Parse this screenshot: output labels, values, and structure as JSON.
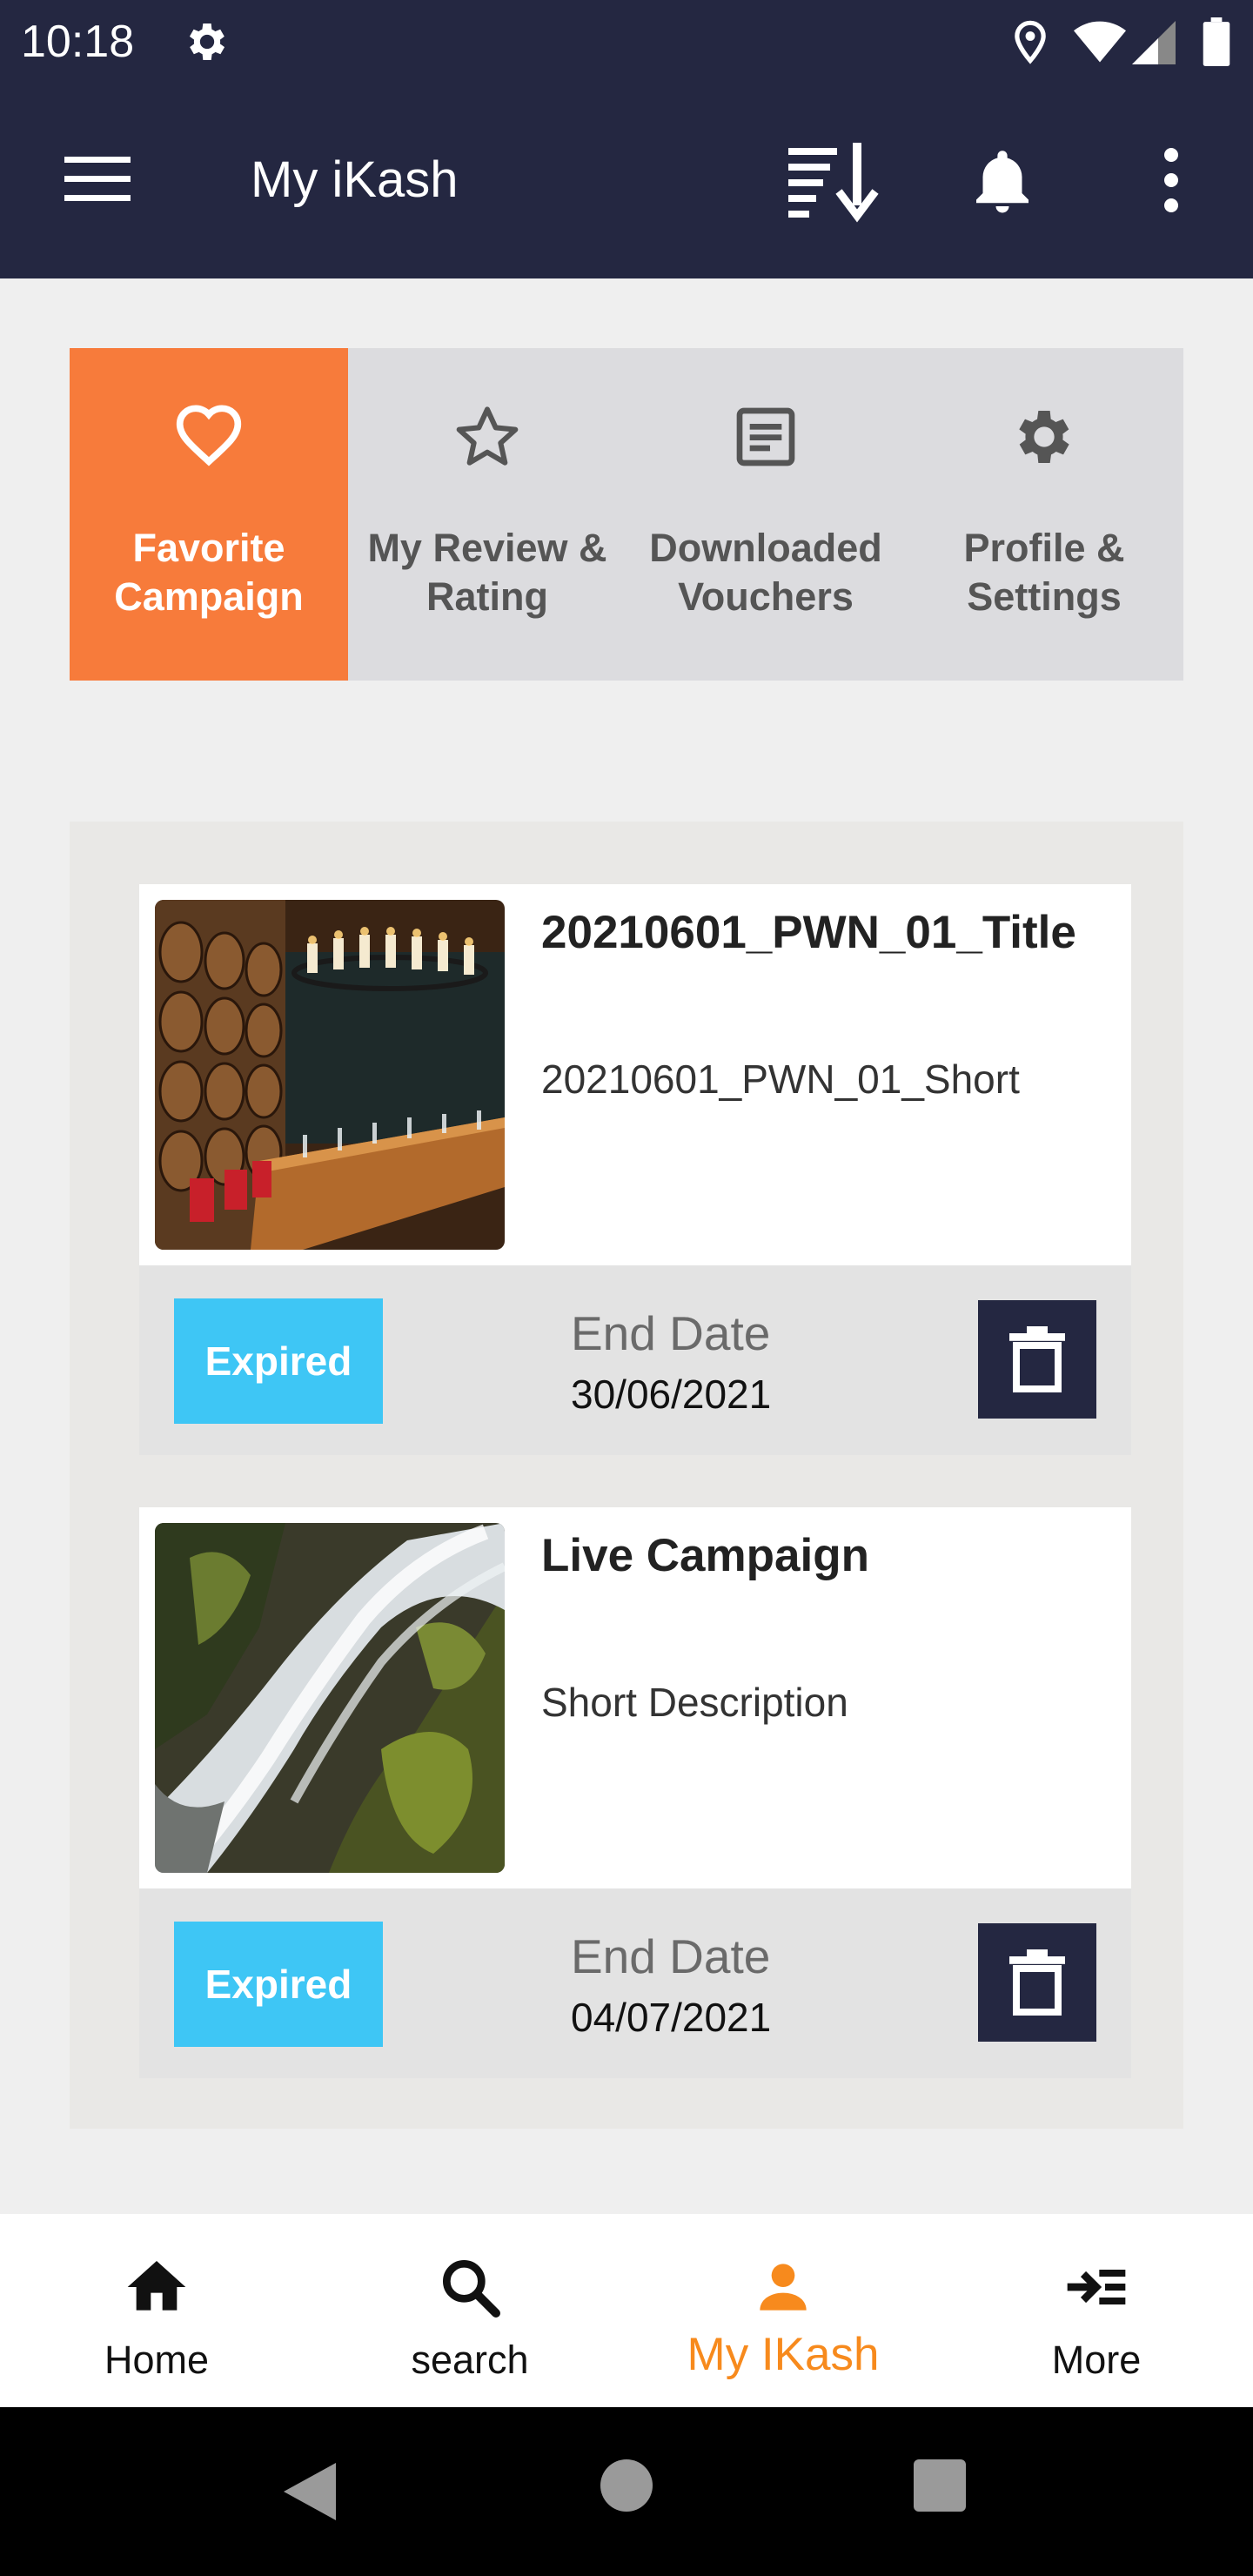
{
  "status_bar": {
    "time": "10:18"
  },
  "app_bar": {
    "title": "My iKash"
  },
  "tabs": [
    {
      "label": "Favorite\nCampaign",
      "icon": "heart-icon",
      "active": true
    },
    {
      "label": "My Review &\nRating",
      "icon": "star-icon",
      "active": false
    },
    {
      "label": "Downloaded\nVouchers",
      "icon": "voucher-icon",
      "active": false
    },
    {
      "label": "Profile &\nSettings",
      "icon": "gear-icon",
      "active": false
    }
  ],
  "campaigns": [
    {
      "title": "20210601_PWN_01_Title",
      "short": "20210601_PWN_01_Short",
      "status": "Expired",
      "end_date_label": "End Date",
      "end_date": "30/06/2021"
    },
    {
      "title": "Live Campaign",
      "short": "Short Description",
      "status": "Expired",
      "end_date_label": "End Date",
      "end_date": "04/07/2021"
    }
  ],
  "bottom_nav": [
    {
      "label": "Home",
      "icon": "home-icon",
      "active": false
    },
    {
      "label": "search",
      "icon": "search-icon",
      "active": false
    },
    {
      "label": "My IKash",
      "icon": "person-icon",
      "active": true
    },
    {
      "label": "More",
      "icon": "more-menu-icon",
      "active": false
    }
  ],
  "colors": {
    "app_bar": "#242741",
    "accent": "#f77b3b",
    "nav_active": "#f78a1d",
    "badge": "#3ec6f5"
  }
}
